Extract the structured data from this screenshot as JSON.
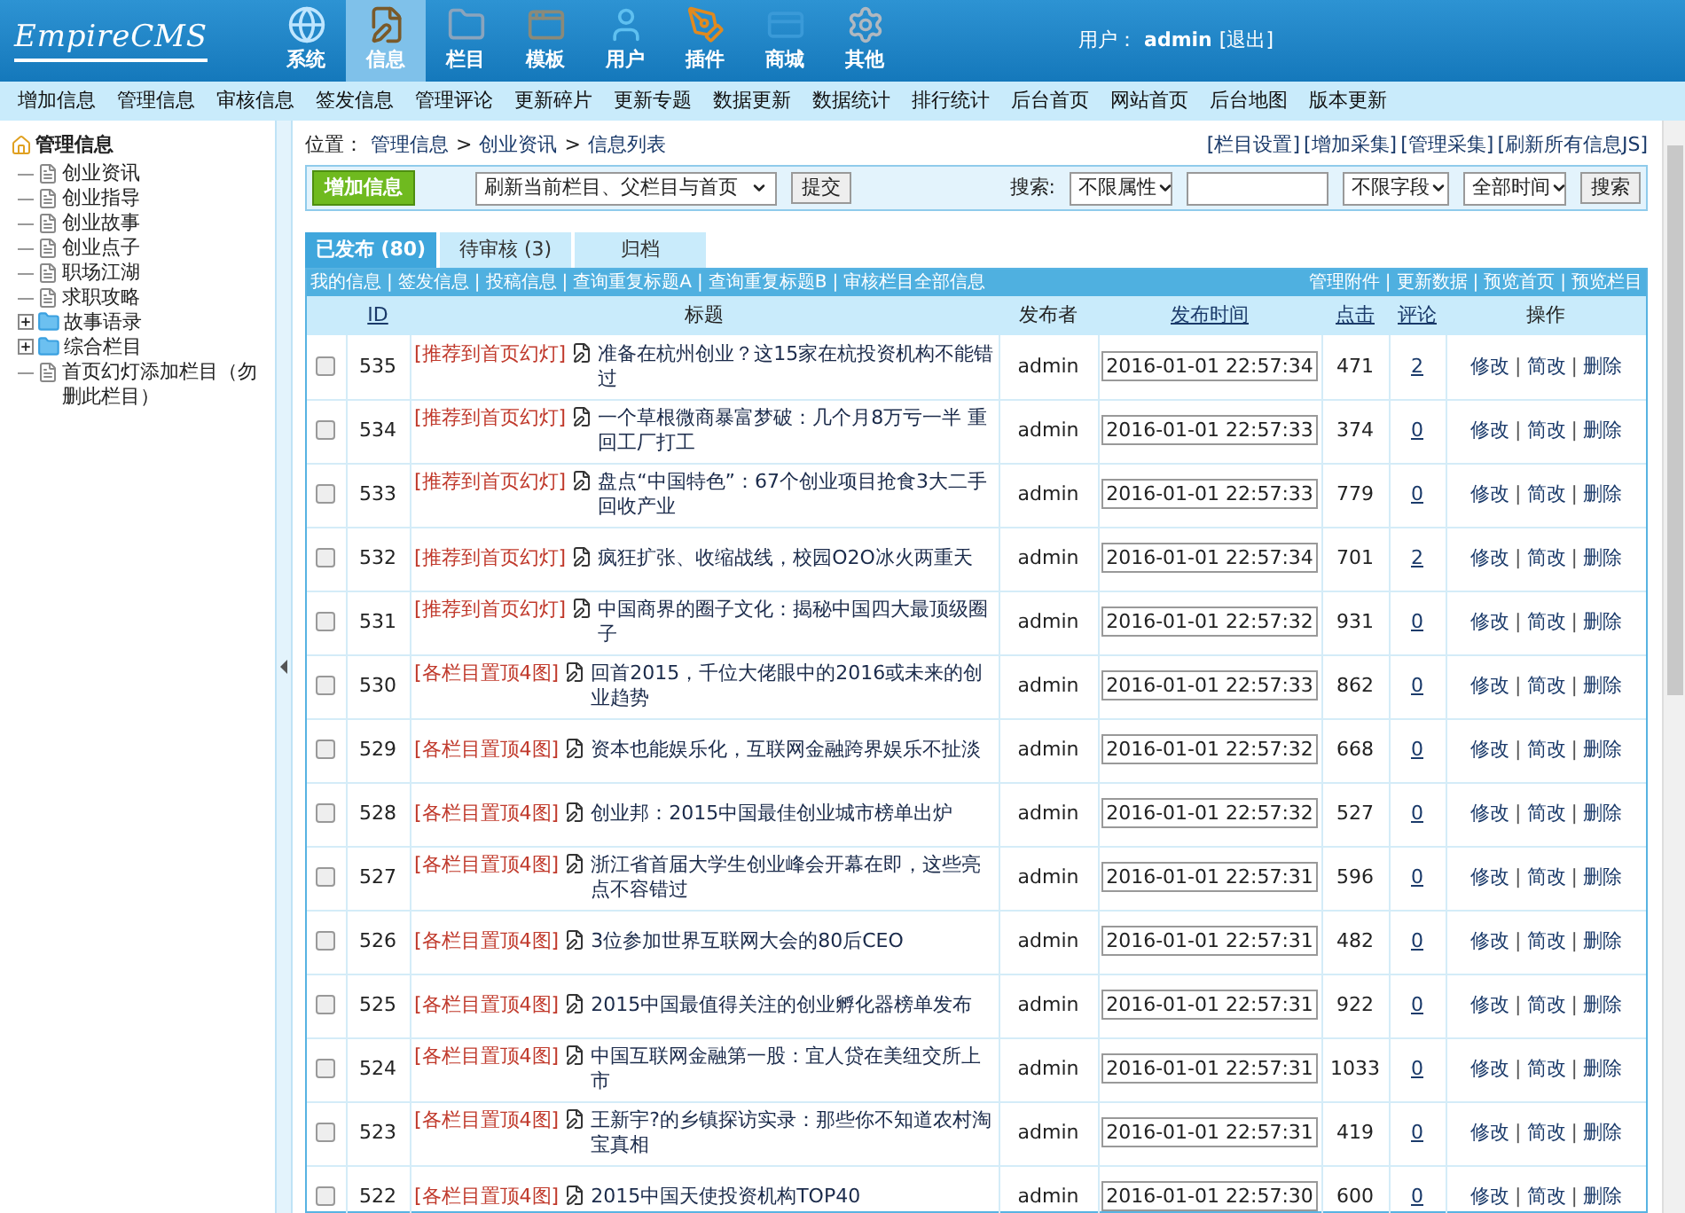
{
  "header": {
    "logo": "EmpireCMS",
    "nav": [
      {
        "label": "系统",
        "selected": false
      },
      {
        "label": "信息",
        "selected": true
      },
      {
        "label": "栏目",
        "selected": false
      },
      {
        "label": "模板",
        "selected": false
      },
      {
        "label": "用户",
        "selected": false
      },
      {
        "label": "插件",
        "selected": false
      },
      {
        "label": "商城",
        "selected": false
      },
      {
        "label": "其他",
        "selected": false
      }
    ],
    "user_label": "用户：",
    "user": "admin",
    "logout": "[退出]"
  },
  "menu": [
    "增加信息",
    "管理信息",
    "审核信息",
    "签发信息",
    "管理评论",
    "更新碎片",
    "更新专题",
    "数据更新",
    "数据统计",
    "排行统计",
    "后台首页",
    "网站首页",
    "后台地图",
    "版本更新"
  ],
  "sidebar": {
    "title": "管理信息",
    "children": [
      {
        "label": "创业资讯",
        "kind": "page"
      },
      {
        "label": "创业指导",
        "kind": "page"
      },
      {
        "label": "创业故事",
        "kind": "page"
      },
      {
        "label": "创业点子",
        "kind": "page"
      },
      {
        "label": "职场江湖",
        "kind": "page"
      },
      {
        "label": "求职攻略",
        "kind": "page"
      },
      {
        "label": "故事语录",
        "kind": "folder",
        "expanded": false
      },
      {
        "label": "综合栏目",
        "kind": "folder",
        "expanded": false
      },
      {
        "label": "首页幻灯添加栏目（勿删此栏目）",
        "kind": "page"
      }
    ]
  },
  "breadcrumb": {
    "label": "位置：",
    "separator": ">",
    "items": [
      "管理信息",
      "创业资讯",
      "信息列表"
    ]
  },
  "top_links": [
    "[栏目设置]",
    "[增加采集]",
    "[管理采集]",
    "[刷新所有信息JS]"
  ],
  "toolbar": {
    "add_button": "增加信息",
    "refresh_select": "刷新当前栏目、父栏目与首页",
    "submit": "提交",
    "search_label": "搜索:",
    "attr_select": "不限属性",
    "field_select": "不限字段",
    "time_select": "全部时间",
    "search_button": "搜索"
  },
  "tabs": [
    {
      "label": "已发布 (80)",
      "selected": true
    },
    {
      "label": "待审核 (3)",
      "selected": false
    },
    {
      "label": "归档",
      "selected": false
    }
  ],
  "sublinks_left": [
    "我的信息",
    "签发信息",
    "投稿信息",
    "查询重复标题A",
    "查询重复标题B",
    "审核栏目全部信息"
  ],
  "sublinks_right": [
    "管理附件",
    "更新数据",
    "预览首页",
    "预览栏目"
  ],
  "link_separator": "|",
  "action_separator": "|",
  "columns": [
    {
      "label": "ID",
      "link": true
    },
    {
      "label": "标题",
      "link": false
    },
    {
      "label": "发布者",
      "link": false
    },
    {
      "label": "发布时间",
      "link": true
    },
    {
      "label": "点击",
      "link": true
    },
    {
      "label": "评论",
      "link": true
    },
    {
      "label": "操作",
      "link": false
    }
  ],
  "rows": [
    {
      "checked": false,
      "id": "535",
      "tag": "[推荐到首页幻灯]",
      "title": "准备在杭州创业？这15家在杭投资机构不能错过",
      "publisher": "admin",
      "time": "2016-01-01 22:57:34",
      "clicks": "471",
      "comments": "2",
      "actions": [
        "修改",
        "简改",
        "删除"
      ]
    },
    {
      "checked": false,
      "id": "534",
      "tag": "[推荐到首页幻灯]",
      "title": "一个草根微商暴富梦破：几个月8万亏一半 重回工厂打工",
      "publisher": "admin",
      "time": "2016-01-01 22:57:33",
      "clicks": "374",
      "comments": "0",
      "actions": [
        "修改",
        "简改",
        "删除"
      ]
    },
    {
      "checked": false,
      "id": "533",
      "tag": "[推荐到首页幻灯]",
      "title": "盘点“中国特色”：67个创业项目抢食3大二手回收产业",
      "publisher": "admin",
      "time": "2016-01-01 22:57:33",
      "clicks": "779",
      "comments": "0",
      "actions": [
        "修改",
        "简改",
        "删除"
      ]
    },
    {
      "checked": false,
      "id": "532",
      "tag": "[推荐到首页幻灯]",
      "title": "疯狂扩张、收缩战线，校园O2O冰火两重天",
      "publisher": "admin",
      "time": "2016-01-01 22:57:34",
      "clicks": "701",
      "comments": "2",
      "actions": [
        "修改",
        "简改",
        "删除"
      ]
    },
    {
      "checked": false,
      "id": "531",
      "tag": "[推荐到首页幻灯]",
      "title": "中国商界的圈子文化：揭秘中国四大最顶级圈子",
      "publisher": "admin",
      "time": "2016-01-01 22:57:32",
      "clicks": "931",
      "comments": "0",
      "actions": [
        "修改",
        "简改",
        "删除"
      ]
    },
    {
      "checked": false,
      "id": "530",
      "tag": "[各栏目置顶4图]",
      "title": "回首2015，千位大佬眼中的2016或未来的创业趋势",
      "publisher": "admin",
      "time": "2016-01-01 22:57:33",
      "clicks": "862",
      "comments": "0",
      "actions": [
        "修改",
        "简改",
        "删除"
      ]
    },
    {
      "checked": false,
      "id": "529",
      "tag": "[各栏目置顶4图]",
      "title": "资本也能娱乐化，互联网金融跨界娱乐不扯淡",
      "publisher": "admin",
      "time": "2016-01-01 22:57:32",
      "clicks": "668",
      "comments": "0",
      "actions": [
        "修改",
        "简改",
        "删除"
      ]
    },
    {
      "checked": false,
      "id": "528",
      "tag": "[各栏目置顶4图]",
      "title": "创业邦：2015中国最佳创业城市榜单出炉",
      "publisher": "admin",
      "time": "2016-01-01 22:57:32",
      "clicks": "527",
      "comments": "0",
      "actions": [
        "修改",
        "简改",
        "删除"
      ]
    },
    {
      "checked": false,
      "id": "527",
      "tag": "[各栏目置顶4图]",
      "title": "浙江省首届大学生创业峰会开幕在即，这些亮点不容错过",
      "publisher": "admin",
      "time": "2016-01-01 22:57:31",
      "clicks": "596",
      "comments": "0",
      "actions": [
        "修改",
        "简改",
        "删除"
      ]
    },
    {
      "checked": false,
      "id": "526",
      "tag": "[各栏目置顶4图]",
      "title": "3位参加世界互联网大会的80后CEO",
      "publisher": "admin",
      "time": "2016-01-01 22:57:31",
      "clicks": "482",
      "comments": "0",
      "actions": [
        "修改",
        "简改",
        "删除"
      ]
    },
    {
      "checked": false,
      "id": "525",
      "tag": "[各栏目置顶4图]",
      "title": "2015中国最值得关注的创业孵化器榜单发布",
      "publisher": "admin",
      "time": "2016-01-01 22:57:31",
      "clicks": "922",
      "comments": "0",
      "actions": [
        "修改",
        "简改",
        "删除"
      ]
    },
    {
      "checked": false,
      "id": "524",
      "tag": "[各栏目置顶4图]",
      "title": "中国互联网金融第一股：宜人贷在美纽交所上市",
      "publisher": "admin",
      "time": "2016-01-01 22:57:31",
      "clicks": "1033",
      "comments": "0",
      "actions": [
        "修改",
        "简改",
        "删除"
      ]
    },
    {
      "checked": false,
      "id": "523",
      "tag": "[各栏目置顶4图]",
      "title": "王新宇?的乡镇探访实录：那些你不知道农村淘宝真相",
      "publisher": "admin",
      "time": "2016-01-01 22:57:31",
      "clicks": "419",
      "comments": "0",
      "actions": [
        "修改",
        "简改",
        "删除"
      ]
    },
    {
      "checked": false,
      "id": "522",
      "tag": "[各栏目置顶4图]",
      "title": "2015中国天使投资机构TOP40",
      "publisher": "admin",
      "time": "2016-01-01 22:57:30",
      "clicks": "600",
      "comments": "0",
      "actions": [
        "修改",
        "简改",
        "删除"
      ]
    }
  ]
}
